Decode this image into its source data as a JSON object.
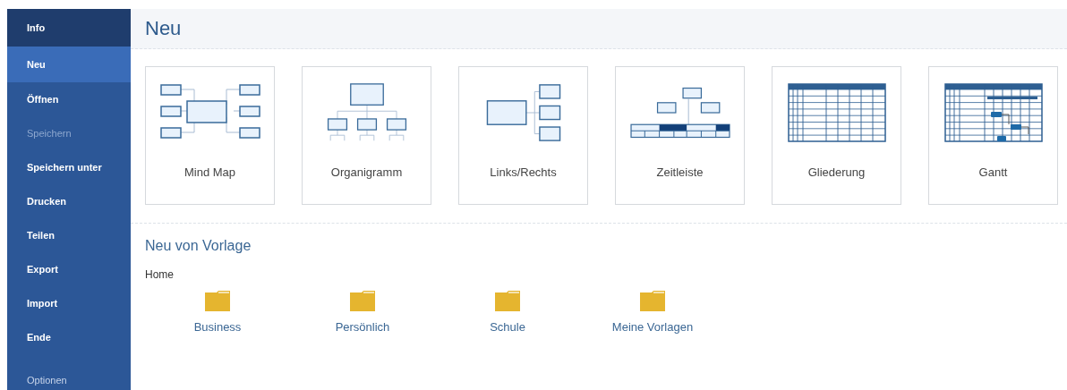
{
  "sidebar": {
    "items": [
      {
        "label": "Info",
        "kind": "top",
        "selected": false,
        "disabled": false
      },
      {
        "label": "Neu",
        "kind": "item",
        "selected": true,
        "disabled": false
      },
      {
        "label": "Öffnen",
        "kind": "item",
        "selected": false,
        "disabled": false
      },
      {
        "label": "Speichern",
        "kind": "item",
        "selected": false,
        "disabled": true
      },
      {
        "label": "Speichern unter",
        "kind": "item",
        "selected": false,
        "disabled": false
      },
      {
        "label": "Drucken",
        "kind": "item",
        "selected": false,
        "disabled": false
      },
      {
        "label": "Teilen",
        "kind": "item",
        "selected": false,
        "disabled": false
      },
      {
        "label": "Export",
        "kind": "item",
        "selected": false,
        "disabled": false
      },
      {
        "label": "Import",
        "kind": "item",
        "selected": false,
        "disabled": false
      },
      {
        "label": "Ende",
        "kind": "item",
        "selected": false,
        "disabled": false
      }
    ],
    "bottom_item": {
      "label": "Optionen"
    }
  },
  "header": {
    "title": "Neu"
  },
  "templates": [
    {
      "label": "Mind Map",
      "kind": "mindmap"
    },
    {
      "label": "Organigramm",
      "kind": "org"
    },
    {
      "label": "Links/Rechts",
      "kind": "leftright"
    },
    {
      "label": "Zeitleiste",
      "kind": "timeline"
    },
    {
      "label": "Gliederung",
      "kind": "outline"
    },
    {
      "label": "Gantt",
      "kind": "gantt"
    }
  ],
  "from_template": {
    "title": "Neu von Vorlage",
    "location": "Home",
    "folders": [
      {
        "label": "Business"
      },
      {
        "label": "Persönlich"
      },
      {
        "label": "Schule"
      },
      {
        "label": "Meine Vorlagen"
      }
    ]
  }
}
